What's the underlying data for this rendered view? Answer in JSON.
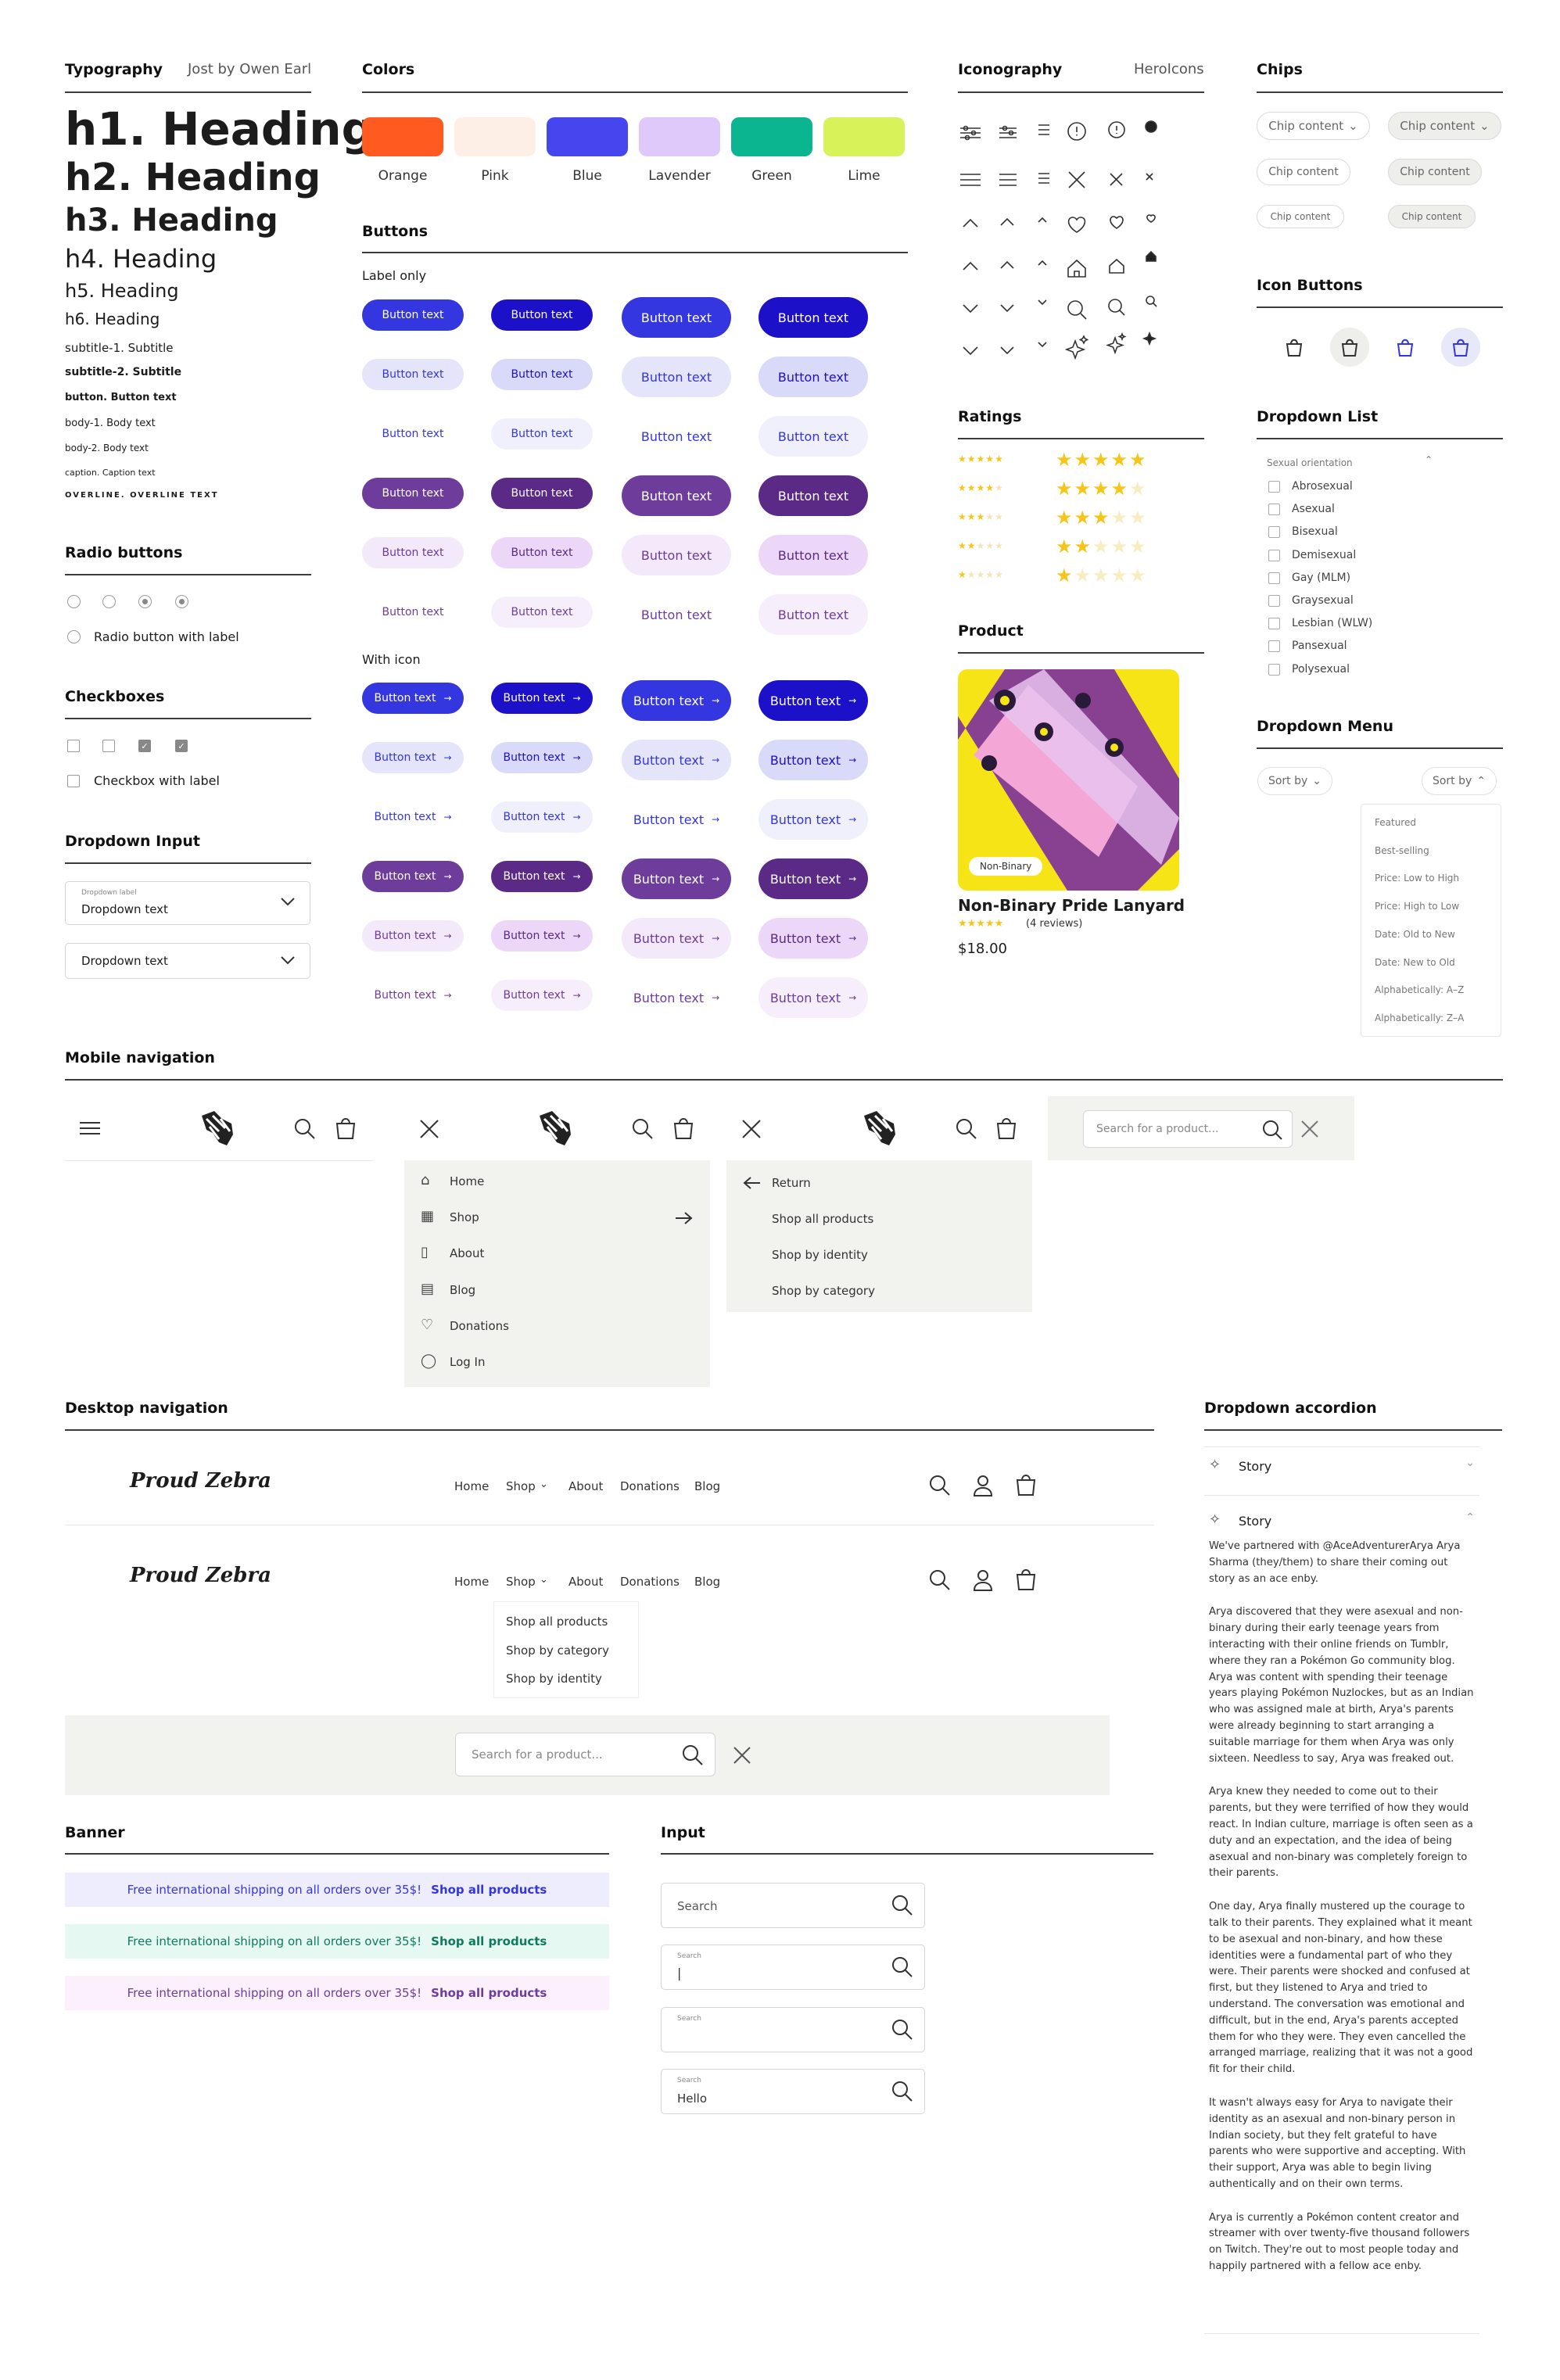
{
  "typography": {
    "title": "Typography",
    "font": "Jost by Owen Earl",
    "h1": "h1. Heading",
    "h2": "h2. Heading",
    "h3": "h3. Heading",
    "h4": "h4. Heading",
    "h5": "h5. Heading",
    "h6": "h6. Heading",
    "subtitle1": "subtitle-1. Subtitle",
    "subtitle2": "subtitle-2. Subtitle",
    "button": "button. Button text",
    "body1": "body-1. Body text",
    "body2": "body-2. Body text",
    "caption": "caption. Caption text",
    "overline": "OVERLINE. OVERLINE TEXT"
  },
  "colors": {
    "title": "Colors",
    "swatches": [
      {
        "name": "Orange",
        "hex": "#ff5a1f"
      },
      {
        "name": "Pink",
        "hex": "#fdeee6"
      },
      {
        "name": "Blue",
        "hex": "#4646ef"
      },
      {
        "name": "Lavender",
        "hex": "#dfc9fb"
      },
      {
        "name": "Green",
        "hex": "#0ab58f"
      },
      {
        "name": "Lime",
        "hex": "#d8f25a"
      }
    ]
  },
  "buttons": {
    "title": "Buttons",
    "label_only": "Label only",
    "with_icon": "With icon",
    "text": "Button text"
  },
  "iconography": {
    "title": "Iconography",
    "set": "HeroIcons"
  },
  "chips": {
    "title": "Chips",
    "label": "Chip content"
  },
  "icon_buttons": {
    "title": "Icon Buttons"
  },
  "radio": {
    "title": "Radio buttons",
    "label": "Radio button with label"
  },
  "checkboxes": {
    "title": "Checkboxes",
    "label": "Checkbox with label"
  },
  "dropdown_input": {
    "title": "Dropdown Input",
    "label": "Dropdown label",
    "value": "Dropdown text",
    "value2": "Dropdown text"
  },
  "ratings": {
    "title": "Ratings",
    "values": [
      5,
      4,
      3,
      2,
      1
    ]
  },
  "product": {
    "title": "Product",
    "badge": "Non-Binary",
    "name": "Non-Binary Pride Lanyard",
    "reviews": "(4 reviews)",
    "price": "$18.00",
    "rating": 5
  },
  "dropdown_list": {
    "title": "Dropdown List",
    "header": "Sexual orientation",
    "items": [
      "Abrosexual",
      "Asexual",
      "Bisexual",
      "Demisexual",
      "Gay (MLM)",
      "Graysexual",
      "Lesbian (WLW)",
      "Pansexual",
      "Polysexual"
    ]
  },
  "dropdown_menu": {
    "title": "Dropdown Menu",
    "sort": "Sort by",
    "options": [
      "Featured",
      "Best-selling",
      "Price: Low to High",
      "Price: High to Low",
      "Date: Old to New",
      "Date: New to Old",
      "Alphabetically: A–Z",
      "Alphabetically: Z–A"
    ]
  },
  "mobile_nav": {
    "title": "Mobile navigation",
    "menu": [
      "Home",
      "Shop",
      "About",
      "Blog",
      "Donations",
      "Log In"
    ],
    "return": "Return",
    "submenu": [
      "Shop all products",
      "Shop by identity",
      "Shop by category"
    ],
    "search_placeholder": "Search for a product..."
  },
  "desktop_nav": {
    "title": "Desktop navigation",
    "logo": "Proud Zebra",
    "links": [
      "Home",
      "Shop",
      "About",
      "Donations",
      "Blog"
    ],
    "shop_menu": [
      "Shop all products",
      "Shop by category",
      "Shop by identity"
    ],
    "search_placeholder": "Search for a product..."
  },
  "accordion": {
    "title": "Dropdown accordion",
    "item": "Story",
    "paragraphs": [
      "We've partnered with @AceAdventurerArya Arya Sharma (they/them) to share their coming out story as an ace enby.",
      "Arya discovered that they were asexual and non-binary during their early teenage years from interacting with their online friends on Tumblr, where they ran a Pokémon Go community blog. Arya was content with spending their teenage years playing Pokémon Nuzlockes, but as an Indian who was assigned male at birth, Arya's parents were already beginning to start arranging a suitable marriage for them when Arya was only sixteen. Needless to say, Arya was freaked out.",
      "Arya knew they needed to come out to their parents, but they were terrified of how they would react. In Indian culture, marriage is often seen as a duty and an expectation, and the idea of being asexual and non-binary was completely foreign to their parents.",
      "One day, Arya finally mustered up the courage to talk to their parents. They explained what it meant to be asexual and non-binary, and how these identities were a fundamental part of who they were. Their parents were shocked and confused at first, but they listened to Arya and tried to understand. The conversation was emotional and difficult, but in the end, Arya's parents accepted them for who they were. They even cancelled the arranged marriage, realizing that it was not a good fit for their child.",
      "It wasn't always easy for Arya to navigate their identity as an asexual and non-binary person in Indian society, but they felt grateful to have parents who were supportive and accepting. With their support, Arya was able to begin living authentically and on their own terms.",
      "Arya is currently a Pokémon content creator and streamer with over twenty-five thousand followers on Twitch. They're out to most people today and happily partnered with a fellow ace enby."
    ]
  },
  "banner": {
    "title": "Banner",
    "text": "Free international shipping on all orders over 35$!",
    "link": "Shop all products"
  },
  "input": {
    "title": "Input",
    "label": "Search",
    "value": "Hello",
    "cursor": "|"
  }
}
